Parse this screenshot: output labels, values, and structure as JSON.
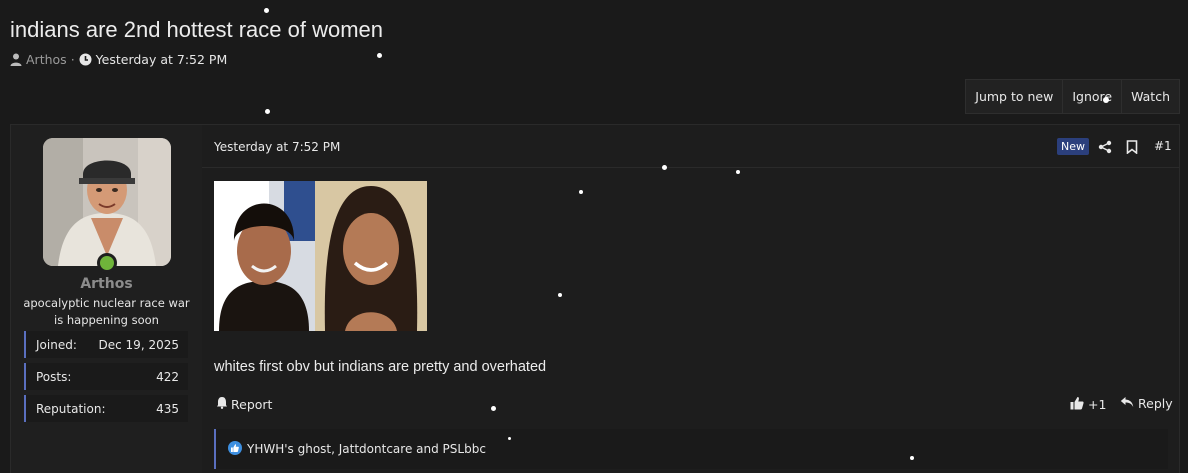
{
  "thread": {
    "title": "indians are 2nd hottest race of women",
    "author": "Arthos",
    "separator": "·",
    "date": "Yesterday at 7:52 PM"
  },
  "actions": {
    "jump_to_new": "Jump to new",
    "ignore": "Ignore",
    "watch": "Watch"
  },
  "user": {
    "name": "Arthos",
    "title": "apocalyptic nuclear race war is happening soon",
    "online": true,
    "stats": [
      {
        "label": "Joined:",
        "value": "Dec 19, 2025"
      },
      {
        "label": "Posts:",
        "value": "422"
      },
      {
        "label": "Reputation:",
        "value": "435"
      }
    ]
  },
  "post": {
    "date": "Yesterday at 7:52 PM",
    "badge": "New",
    "number": "#1",
    "message": "whites first obv but indians are pretty and overhated",
    "report_label": "Report",
    "like_count": "+1",
    "reply_label": "Reply",
    "reactions_text": "YHWH's ghost, Jattdontcare and PSLbbc"
  },
  "icons": {
    "user": "user-icon",
    "clock": "clock-icon",
    "share": "share-icon",
    "bookmark": "bookmark-icon",
    "bell": "bell-icon",
    "like": "thumbs-up-icon",
    "reply": "reply-icon",
    "reaction": "like-reaction-icon"
  },
  "colors": {
    "background": "#1a1a1a",
    "accent": "#5a6fbf",
    "badge": "#2b3f7c",
    "online": "#6fb43a",
    "reaction": "#3d8fe0"
  }
}
